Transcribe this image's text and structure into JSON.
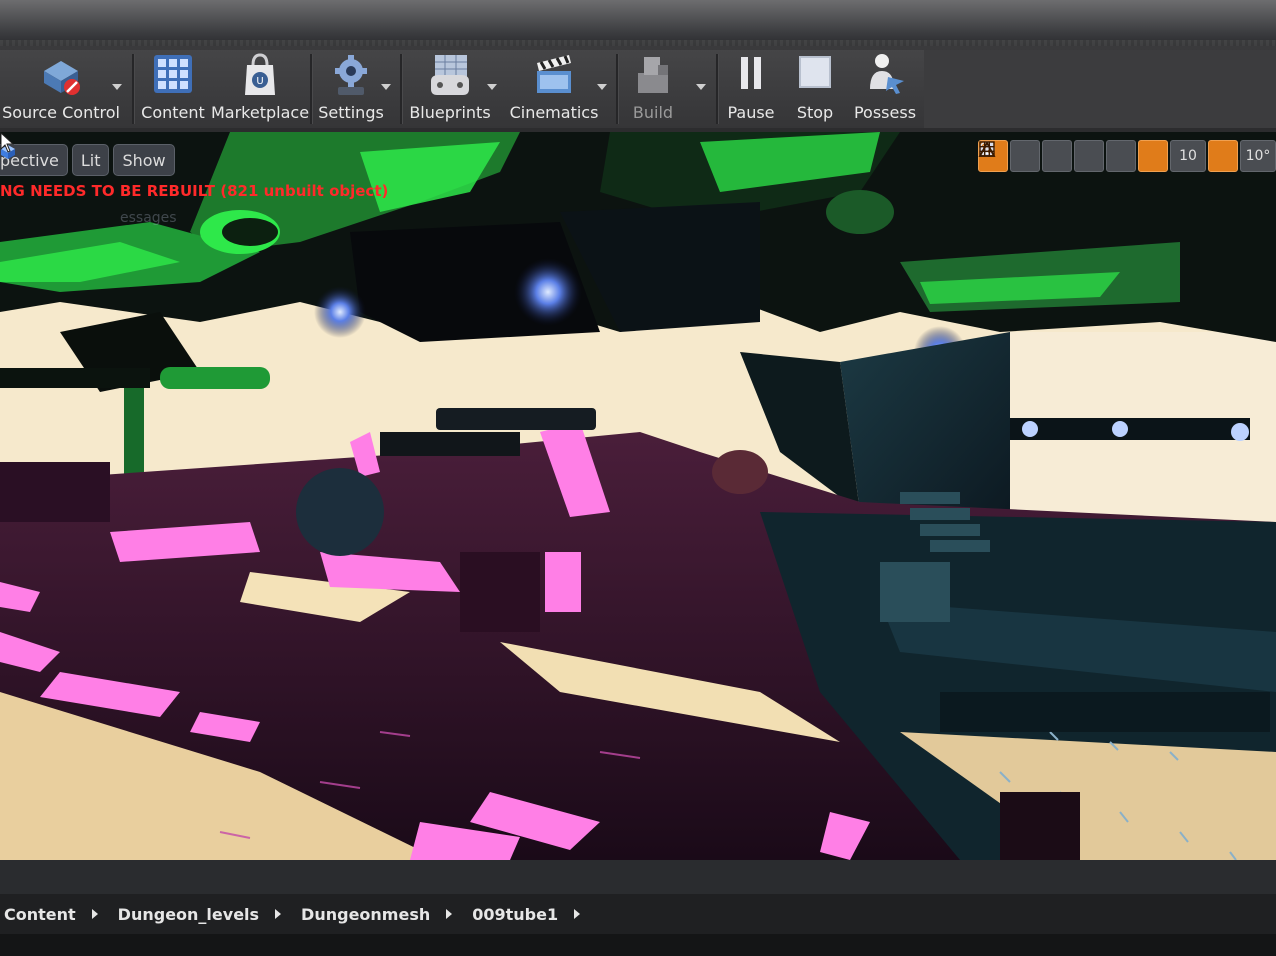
{
  "toolbar": {
    "items": [
      {
        "label": "Source Control",
        "icon": "source-control-icon",
        "dropdown": true
      },
      {
        "label": "Content",
        "icon": "content-grid-icon",
        "dropdown": false
      },
      {
        "label": "Marketplace",
        "icon": "marketplace-bag-icon",
        "dropdown": false
      },
      {
        "label": "Settings",
        "icon": "settings-gear-icon",
        "dropdown": true
      },
      {
        "label": "Blueprints",
        "icon": "blueprints-gamepad-icon",
        "dropdown": true
      },
      {
        "label": "Cinematics",
        "icon": "cinematics-clapper-icon",
        "dropdown": true
      },
      {
        "label": "Build",
        "icon": "build-blocks-icon",
        "dropdown": true
      },
      {
        "label": "Pause",
        "icon": "pause-icon",
        "dropdown": false
      },
      {
        "label": "Stop",
        "icon": "stop-icon",
        "dropdown": false
      },
      {
        "label": "Possess",
        "icon": "possess-person-icon",
        "dropdown": false
      }
    ]
  },
  "viewport": {
    "view_mode": "pective",
    "lit_label": "Lit",
    "show_label": "Show",
    "warning": "NG NEEDS TO BE REBUILT (821 unbuilt object)",
    "warning_sub": "essages",
    "grid_snap_value": "10",
    "rotation_snap_value": "10°"
  },
  "breadcrumb": {
    "items": [
      "Content",
      "Dungeon_levels",
      "Dungeonmesh",
      "009tube1"
    ]
  },
  "colors": {
    "warning": "#ff2a2a",
    "accent_orange": "#e07c1a",
    "neon_green": "#2ee84a",
    "neon_pink": "#ff7fe6",
    "toolbar_bg": "#3a3a3c"
  }
}
